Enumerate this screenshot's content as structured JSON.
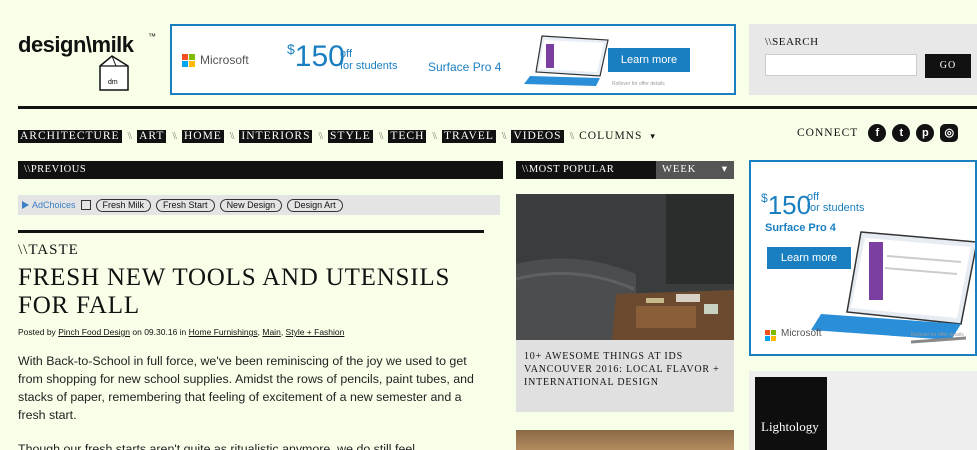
{
  "logo": {
    "text": "design\\milk",
    "tm": "™",
    "badge": "dm"
  },
  "banner_ad": {
    "brand": "Microsoft",
    "price_symbol": "$",
    "price": "150",
    "off_line1": "off",
    "off_line2": "for students",
    "product": "Surface Pro 4",
    "cta": "Learn more",
    "fine_print": "Rollover for offer details",
    "accent_color": "#1a7fc1"
  },
  "search": {
    "label": "\\\\SEARCH",
    "placeholder": "",
    "button": "GO"
  },
  "nav": {
    "items": [
      "ARCHITECTURE",
      "ART",
      "HOME",
      "INTERIORS",
      "STYLE",
      "TECH",
      "TRAVEL",
      "VIDEOS"
    ],
    "separator": "\\\\",
    "columns": "COLUMNS",
    "columns_caret": "▾"
  },
  "connect": {
    "label": "CONNECT",
    "icons": [
      "facebook-icon",
      "twitter-icon",
      "pinterest-icon",
      "instagram-icon"
    ]
  },
  "previous": {
    "label": "\\\\PREVIOUS"
  },
  "ad_choices": {
    "label": "AdChoices",
    "pills": [
      "Fresh Milk",
      "Fresh Start",
      "New Design",
      "Design Art"
    ]
  },
  "article": {
    "category": "\\\\TASTE",
    "title": "FRESH NEW TOOLS AND UTENSILS FOR FALL",
    "byline_prefix": "Posted by",
    "author": "Pinch Food Design",
    "date_text": "on 09.30.16 in",
    "tags": [
      "Home Furnishings",
      "Main",
      "Style + Fashion"
    ],
    "paragraph1": "With Back-to-School in full force, we've been reminiscing of the joy we used to get from shopping for new school supplies. Amidst the rows of pencils, paint tubes, and stacks of paper, remembering that feeling of excitement of a new semester and a fresh start.",
    "paragraph2": "Though our fresh starts aren't quite as ritualistic anymore, we do still feel"
  },
  "most_popular": {
    "label": "\\\\MOST POPULAR",
    "period": "WEEK",
    "period_caret": "▾",
    "items": [
      {
        "caption": "10+ AWESOME THINGS AT IDS VANCOUVER 2016: LOCAL FLAVOR + INTERNATIONAL DESIGN"
      }
    ]
  },
  "side_ad": {
    "price_symbol": "$",
    "price": "150",
    "off_line1": "off",
    "off_line2": "for students",
    "product": "Surface Pro 4",
    "cta": "Learn more",
    "brand": "Microsoft",
    "fine_print": "Rollover for offer details"
  },
  "lightology": {
    "name": "Lightology"
  }
}
